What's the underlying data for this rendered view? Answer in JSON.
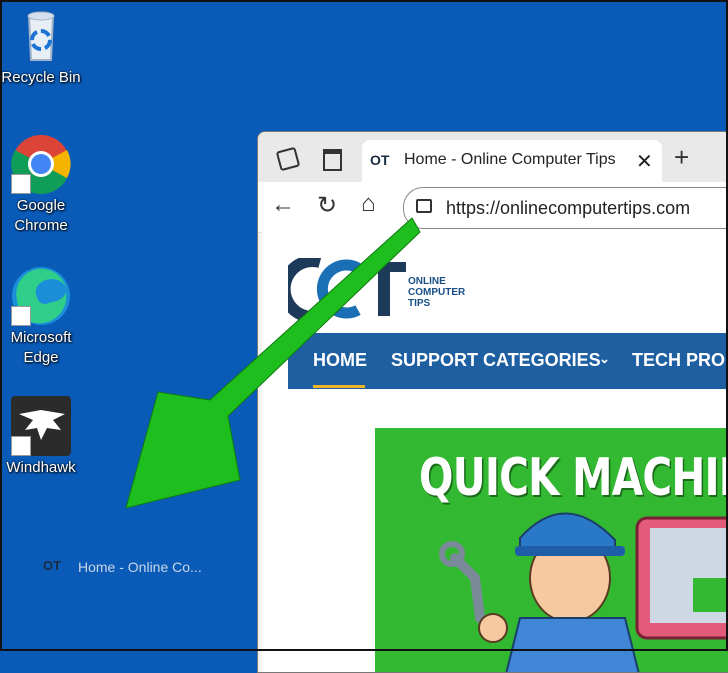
{
  "desktop": {
    "icons": [
      {
        "label": "Recycle Bin"
      },
      {
        "label": "Google\nChrome"
      },
      {
        "label": "Microsoft\nEdge"
      },
      {
        "label": "Windhawk"
      }
    ],
    "drag_label": "Home - Online Co..."
  },
  "browser": {
    "tab_title": "Home - Online Computer Tips",
    "url": "https://onlinecomputertips.com"
  },
  "site": {
    "logo_line1": "ONLINE",
    "logo_line2": "COMPUTER",
    "logo_line3": "TIPS",
    "nav": [
      "HOME",
      "SUPPORT CATEGORIES",
      "TECH PROD"
    ],
    "banner_title": "QUICK MACHINE"
  },
  "colors": {
    "desktop": "#0a5bb8",
    "nav": "#1d5fa0",
    "banner": "#33b832",
    "arrow": "#1fbe1f"
  }
}
